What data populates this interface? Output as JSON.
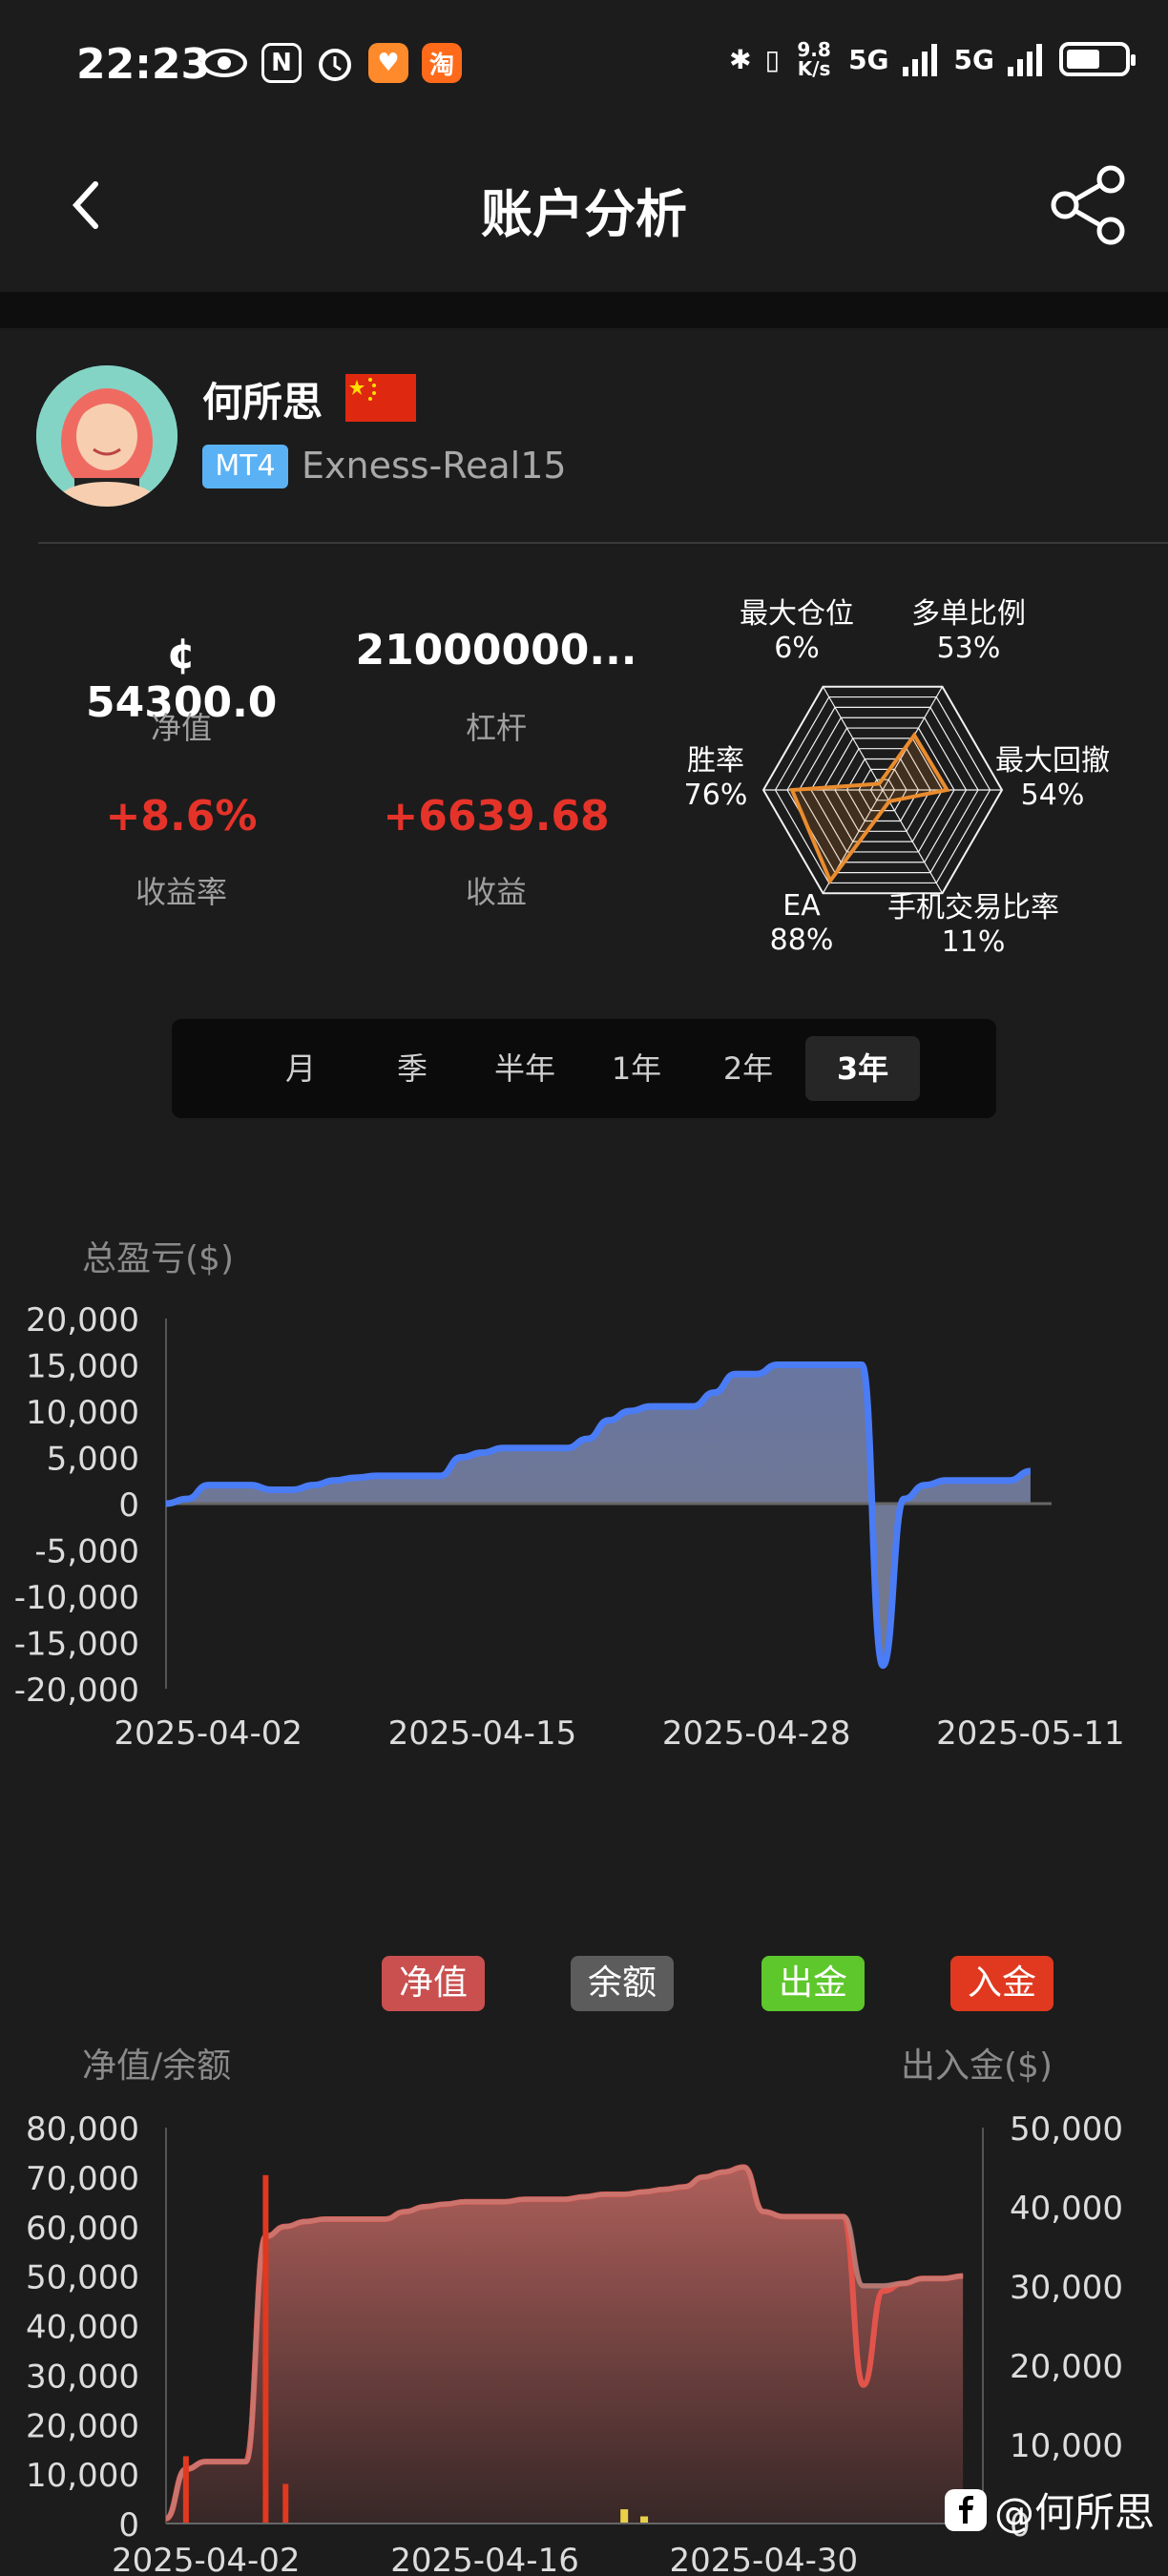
{
  "status_bar": {
    "time": "22:23",
    "network_speed": "9.8 K/s",
    "signal_1": "5G",
    "signal_2": "5G",
    "app_icons": [
      "eye-icon",
      "nfc-icon",
      "alarm-icon",
      "heart-app-icon",
      "taobao-icon"
    ],
    "taobao_label": "淘"
  },
  "header": {
    "title": "账户分析"
  },
  "profile": {
    "name": "何所思",
    "platform_badge": "MT4",
    "server": "Exness-Real15"
  },
  "stats": {
    "equity_value": "¢ 54300.0",
    "equity_label": "净值",
    "leverage_value": "21000000...",
    "leverage_label": "杠杆",
    "return_value": "+8.6%",
    "return_label": "收益率",
    "profit_value": "+6639.68",
    "profit_label": "收益"
  },
  "radar": {
    "axes": [
      {
        "name": "多单比例",
        "value": "53%"
      },
      {
        "name": "最大回撤",
        "value": "54%"
      },
      {
        "name": "手机交易比率",
        "value": "11%"
      },
      {
        "name": "EA",
        "value": "88%"
      },
      {
        "name": "胜率",
        "value": "76%"
      },
      {
        "name": "最大仓位",
        "value": "6%"
      }
    ],
    "values": [
      0.53,
      0.54,
      0.11,
      0.88,
      0.76,
      0.06
    ]
  },
  "tabs": [
    "月",
    "季",
    "半年",
    "1年",
    "2年",
    "3年"
  ],
  "active_tab": "3年",
  "chart_data": [
    {
      "type": "area",
      "title": "总盈亏($)",
      "ylim": [
        -20000,
        20000
      ],
      "yticks": [
        "20,000",
        "15,000",
        "10,000",
        "5,000",
        "0",
        "-5,000",
        "-10,000",
        "-15,000",
        "-20,000"
      ],
      "xticks": [
        "2025-04-02",
        "2025-04-15",
        "2025-04-28",
        "2025-05-11"
      ],
      "x_range": [
        "2025-03-31",
        "2025-05-12"
      ],
      "series": [
        {
          "x": [
            "2025-03-31",
            "2025-04-01",
            "2025-04-02",
            "2025-04-03",
            "2025-04-04",
            "2025-04-05",
            "2025-04-06",
            "2025-04-07",
            "2025-04-08",
            "2025-04-09",
            "2025-04-10",
            "2025-04-11",
            "2025-04-12",
            "2025-04-13",
            "2025-04-14",
            "2025-04-15",
            "2025-04-16",
            "2025-04-17",
            "2025-04-18",
            "2025-04-19",
            "2025-04-20",
            "2025-04-21",
            "2025-04-22",
            "2025-04-23",
            "2025-04-24",
            "2025-04-25",
            "2025-04-26",
            "2025-04-27",
            "2025-04-28",
            "2025-04-29",
            "2025-04-30",
            "2025-05-01",
            "2025-05-02",
            "2025-05-03",
            "2025-05-04",
            "2025-05-05",
            "2025-05-06",
            "2025-05-07",
            "2025-05-08",
            "2025-05-09",
            "2025-05-10",
            "2025-05-11"
          ],
          "values": [
            0,
            500,
            2000,
            2000,
            2000,
            1500,
            1500,
            2000,
            2500,
            2800,
            3000,
            3000,
            3000,
            3000,
            5000,
            5500,
            6000,
            6000,
            6000,
            6000,
            7000,
            9000,
            10000,
            10500,
            10500,
            10500,
            12000,
            14000,
            14000,
            15000,
            15000,
            15000,
            15000,
            15000,
            -17500,
            500,
            2000,
            2500,
            2500,
            2500,
            2500,
            3500
          ]
        }
      ]
    },
    {
      "type": "area",
      "y_left_label": "净值/余额",
      "y_right_label": "出入金($)",
      "ylim_left": [
        0,
        80000
      ],
      "ylim_right": [
        0,
        50000
      ],
      "yticks_left": [
        "80,000",
        "70,000",
        "60,000",
        "50,000",
        "40,000",
        "30,000",
        "20,000",
        "10,000",
        "0"
      ],
      "yticks_right": [
        "50,000",
        "40,000",
        "30,000",
        "20,000",
        "10,000",
        "0"
      ],
      "xticks": [
        "2025-04-02",
        "2025-04-16",
        "2025-04-30"
      ],
      "legend": [
        "净值",
        "余额",
        "出金",
        "入金"
      ],
      "colors": {
        "equity": "#c9504f",
        "balance": "#606060",
        "withdraw": "#5ec72b",
        "deposit": "#e0391f"
      },
      "x_range": [
        "2025-03-31",
        "2025-05-11"
      ],
      "x": [
        "2025-03-31",
        "2025-04-01",
        "2025-04-02",
        "2025-04-03",
        "2025-04-04",
        "2025-04-05",
        "2025-04-06",
        "2025-04-07",
        "2025-04-08",
        "2025-04-09",
        "2025-04-10",
        "2025-04-11",
        "2025-04-12",
        "2025-04-13",
        "2025-04-14",
        "2025-04-15",
        "2025-04-16",
        "2025-04-17",
        "2025-04-18",
        "2025-04-19",
        "2025-04-20",
        "2025-04-21",
        "2025-04-22",
        "2025-04-23",
        "2025-04-24",
        "2025-04-25",
        "2025-04-26",
        "2025-04-27",
        "2025-04-28",
        "2025-04-29",
        "2025-04-30",
        "2025-05-01",
        "2025-05-02",
        "2025-05-03",
        "2025-05-04",
        "2025-05-05",
        "2025-05-06",
        "2025-05-07",
        "2025-05-08",
        "2025-05-09",
        "2025-05-10"
      ],
      "series": [
        {
          "name": "净值",
          "values": [
            1000,
            11000,
            12500,
            12500,
            12500,
            58000,
            60000,
            61000,
            61500,
            61500,
            61500,
            61500,
            63000,
            64000,
            64500,
            65000,
            65000,
            65000,
            65500,
            65500,
            65500,
            66000,
            66500,
            66500,
            67000,
            67500,
            68000,
            70000,
            71000,
            72000,
            63000,
            62000,
            62000,
            62000,
            62000,
            28000,
            47000,
            48500,
            49500,
            49500,
            50000
          ]
        },
        {
          "name": "余额",
          "values": [
            1000,
            11000,
            12500,
            12500,
            12500,
            58000,
            60000,
            61000,
            61500,
            61500,
            61500,
            61500,
            63000,
            64000,
            64500,
            65000,
            65000,
            65000,
            65500,
            65500,
            65500,
            66000,
            66500,
            66500,
            67000,
            67500,
            68000,
            70000,
            71000,
            72000,
            63000,
            62000,
            62000,
            62000,
            62000,
            48000,
            48000,
            48500,
            49500,
            49500,
            50000
          ]
        }
      ],
      "deposits": [
        {
          "x": "2025-04-01",
          "value": 8500
        },
        {
          "x": "2025-04-05",
          "value": 44000
        },
        {
          "x": "2025-04-06",
          "value": 5000
        }
      ],
      "withdrawals": [
        {
          "x": "2025-04-23",
          "value": 1800
        },
        {
          "x": "2025-04-24",
          "value": 900
        }
      ]
    }
  ],
  "watermark": "@何所思"
}
